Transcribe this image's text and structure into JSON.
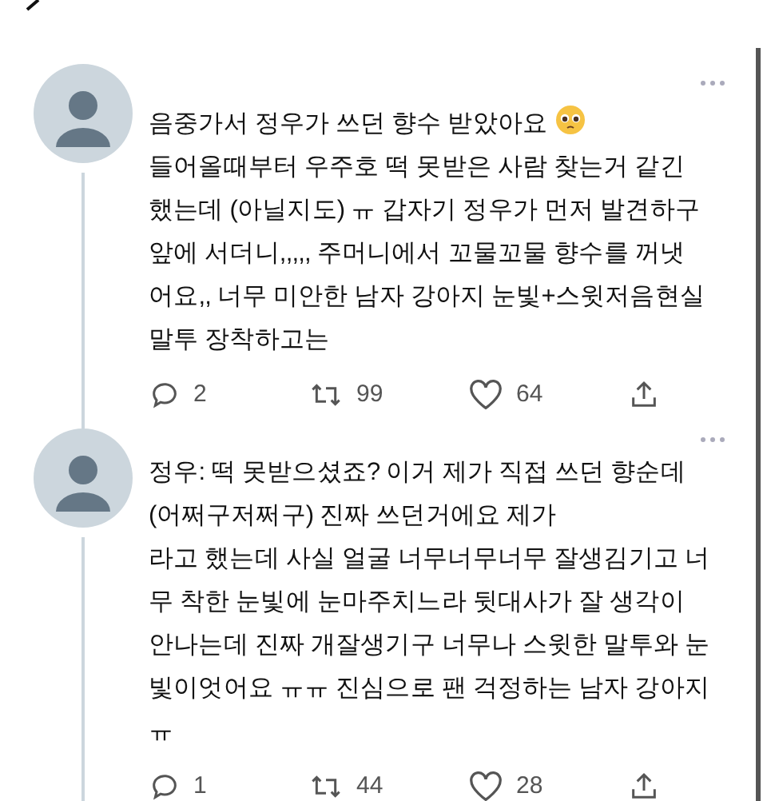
{
  "tweets": [
    {
      "text": "음중가서 정우가 쓰던 향수 받았아요\n들어올때부터 우주호 떡 못받은 사람 찾는거 같긴\n했는데 (아닐지도) ㅠ 갑자기 정우가 먼저 발견하구\n앞에 서더니,,,,, 주머니에서 꼬물꼬물 향수를 꺼냇\n어요,, 너무 미안한 남자 강아지 눈빛+스윗저음현실\n말투 장착하고는",
      "emoji": true,
      "replies": "2",
      "retweets": "99",
      "likes": "64"
    },
    {
      "text": "정우: 떡 못받으셨죠? 이거 제가 직접 쓰던 향순데\n(어쩌구저쩌구) 진짜 쓰던거에요 제가\n라고 했는데 사실 얼굴 너무너무너무 잘생김기고 너\n무 착한 눈빛에 눈마주치느라 뒷대사가 잘 생각이\n안나는데 진짜 개잘생기구 너무나 스윗한 말투와 눈\n빛이엇어요 ㅠㅠ 진심으로 팬 걱정하는 남자 강아지\nㅠ",
      "emoji": false,
      "replies": "1",
      "retweets": "44",
      "likes": "28"
    }
  ]
}
